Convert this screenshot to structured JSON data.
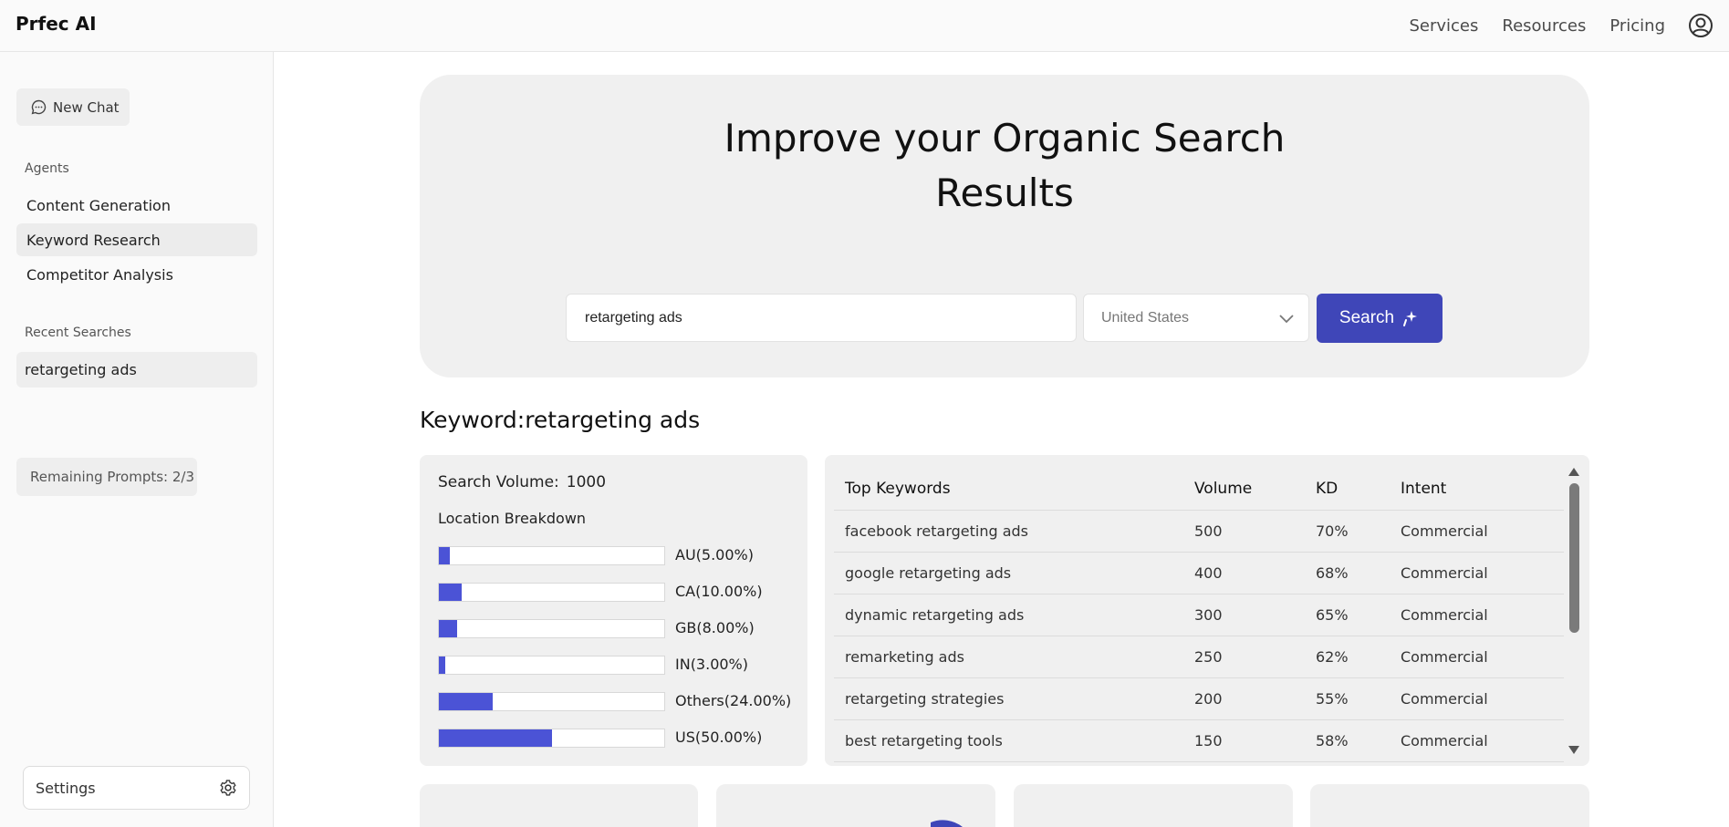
{
  "header": {
    "brand": "Prfec AI",
    "nav": [
      "Services",
      "Resources",
      "Pricing"
    ],
    "user_icon": "user-circle-icon"
  },
  "sidebar": {
    "new_chat": "New Chat",
    "agents_label": "Agents",
    "agents": [
      "Content Generation",
      "Keyword Research",
      "Competitor Analysis"
    ],
    "active_agent": "Keyword Research",
    "recent_label": "Recent Searches",
    "recent": [
      "retargeting ads"
    ],
    "remaining_prompts": "Remaining Prompts: 2/3",
    "settings": "Settings"
  },
  "hero": {
    "title_line1": "Improve your Organic Search",
    "title_line2": "Results",
    "search_value": "retargeting ads",
    "country": "United States",
    "search_button": "Search"
  },
  "keyword_heading": "Keyword:retargeting ads",
  "volume": {
    "label": "Search Volume:",
    "value": "1000",
    "breakdown_label": "Location Breakdown",
    "locations": [
      {
        "label": "AU(5.00%)",
        "percent": 5
      },
      {
        "label": "CA(10.00%)",
        "percent": 10
      },
      {
        "label": "GB(8.00%)",
        "percent": 8
      },
      {
        "label": "IN(3.00%)",
        "percent": 3
      },
      {
        "label": "Others(24.00%)",
        "percent": 24
      },
      {
        "label": "US(50.00%)",
        "percent": 50
      }
    ],
    "bar_color": "#4b53d6"
  },
  "keywords_table": {
    "headers": [
      "Top Keywords",
      "Volume",
      "KD",
      "Intent"
    ],
    "rows": [
      [
        "facebook retargeting ads",
        "500",
        "70%",
        "Commercial"
      ],
      [
        "google retargeting ads",
        "400",
        "68%",
        "Commercial"
      ],
      [
        "dynamic retargeting ads",
        "300",
        "65%",
        "Commercial"
      ],
      [
        "remarketing ads",
        "250",
        "62%",
        "Commercial"
      ],
      [
        "retargeting strategies",
        "200",
        "55%",
        "Commercial"
      ],
      [
        "best retargeting tools",
        "150",
        "58%",
        "Commercial"
      ]
    ]
  },
  "colors": {
    "accent": "#3f46b8",
    "card_bg": "#f0f0f0"
  }
}
